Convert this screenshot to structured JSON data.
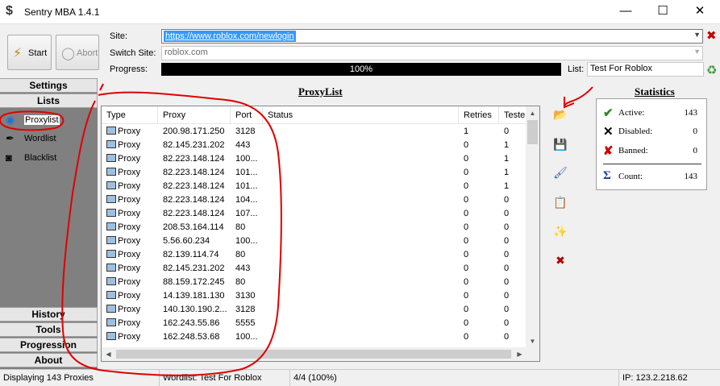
{
  "window": {
    "title": "Sentry MBA 1.4.1",
    "minimize_glyph": "—",
    "maximize_glyph": "☐",
    "close_glyph": "✕"
  },
  "toolbar": {
    "start_label": "Start",
    "abort_label": "Abort",
    "site_label": "Site:",
    "site_value": "https://www.roblox.com/newlogin",
    "switch_site_label": "Switch Site:",
    "switch_site_value": "roblox.com",
    "progress_label": "Progress:",
    "progress_text": "100%",
    "progress_value": 1.0,
    "list_label": "List:",
    "list_value": "Test For Roblox"
  },
  "sidebar": {
    "settings": "Settings",
    "lists": "Lists",
    "items": [
      {
        "label": "Proxylist",
        "icon": "proxy-globe-icon",
        "selected": true
      },
      {
        "label": "Wordlist",
        "icon": "pen-icon"
      },
      {
        "label": "Blacklist",
        "icon": "blacklist-icon"
      }
    ],
    "history": "History",
    "tools": "Tools",
    "progression": "Progression",
    "about": "About"
  },
  "proxylist": {
    "title": "ProxyList",
    "columns": [
      "Type",
      "Proxy",
      "Port",
      "Status",
      "Retries",
      "Teste"
    ],
    "rows": [
      {
        "type": "Proxy",
        "proxy": "200.98.171.250",
        "port": "3128",
        "status": "",
        "retries": "1",
        "tested": "0"
      },
      {
        "type": "Proxy",
        "proxy": "82.145.231.202",
        "port": "443",
        "status": "",
        "retries": "0",
        "tested": "1"
      },
      {
        "type": "Proxy",
        "proxy": "82.223.148.124",
        "port": "100...",
        "status": "",
        "retries": "0",
        "tested": "1"
      },
      {
        "type": "Proxy",
        "proxy": "82.223.148.124",
        "port": "101...",
        "status": "",
        "retries": "0",
        "tested": "1"
      },
      {
        "type": "Proxy",
        "proxy": "82.223.148.124",
        "port": "101...",
        "status": "",
        "retries": "0",
        "tested": "1"
      },
      {
        "type": "Proxy",
        "proxy": "82.223.148.124",
        "port": "104...",
        "status": "",
        "retries": "0",
        "tested": "0"
      },
      {
        "type": "Proxy",
        "proxy": "82.223.148.124",
        "port": "107...",
        "status": "",
        "retries": "0",
        "tested": "0"
      },
      {
        "type": "Proxy",
        "proxy": "208.53.164.114",
        "port": "80",
        "status": "",
        "retries": "0",
        "tested": "0"
      },
      {
        "type": "Proxy",
        "proxy": "5.56.60.234",
        "port": "100...",
        "status": "",
        "retries": "0",
        "tested": "0"
      },
      {
        "type": "Proxy",
        "proxy": "82.139.114.74",
        "port": "80",
        "status": "",
        "retries": "0",
        "tested": "0"
      },
      {
        "type": "Proxy",
        "proxy": "82.145.231.202",
        "port": "443",
        "status": "",
        "retries": "0",
        "tested": "0"
      },
      {
        "type": "Proxy",
        "proxy": "88.159.172.245",
        "port": "80",
        "status": "",
        "retries": "0",
        "tested": "0"
      },
      {
        "type": "Proxy",
        "proxy": "14.139.181.130",
        "port": "3130",
        "status": "",
        "retries": "0",
        "tested": "0"
      },
      {
        "type": "Proxy",
        "proxy": "140.130.190.2...",
        "port": "3128",
        "status": "",
        "retries": "0",
        "tested": "0"
      },
      {
        "type": "Proxy",
        "proxy": "162.243.55.86",
        "port": "5555",
        "status": "",
        "retries": "0",
        "tested": "0"
      },
      {
        "type": "Proxy",
        "proxy": "162.248.53.68",
        "port": "100...",
        "status": "",
        "retries": "0",
        "tested": "0"
      }
    ]
  },
  "tools": [
    {
      "icon": "open-folder-icon",
      "glyph": "📂"
    },
    {
      "icon": "save-icon",
      "glyph": "💾"
    },
    {
      "icon": "clean-brush-icon",
      "glyph": "🖌"
    },
    {
      "icon": "paste-clipboard-icon",
      "glyph": "📋"
    },
    {
      "icon": "magic-wand-icon",
      "glyph": "✨"
    },
    {
      "icon": "delete-x-icon",
      "glyph": "✖"
    }
  ],
  "statistics": {
    "title": "Statistics",
    "active_label": "Active:",
    "active_value": "143",
    "disabled_label": "Disabled:",
    "disabled_value": "0",
    "banned_label": "Banned:",
    "banned_value": "0",
    "count_label": "Count:",
    "count_value": "143"
  },
  "statusbar": {
    "proxies": "Displaying 143 Proxies",
    "wordlist": "Wordlist: Test For Roblox",
    "progress": "4/4 (100%)",
    "ip": "IP: 123.2.218.62"
  },
  "colors": {
    "annotation": "#e00000",
    "progress_fill": "#000000",
    "selection": "#3399ff"
  }
}
